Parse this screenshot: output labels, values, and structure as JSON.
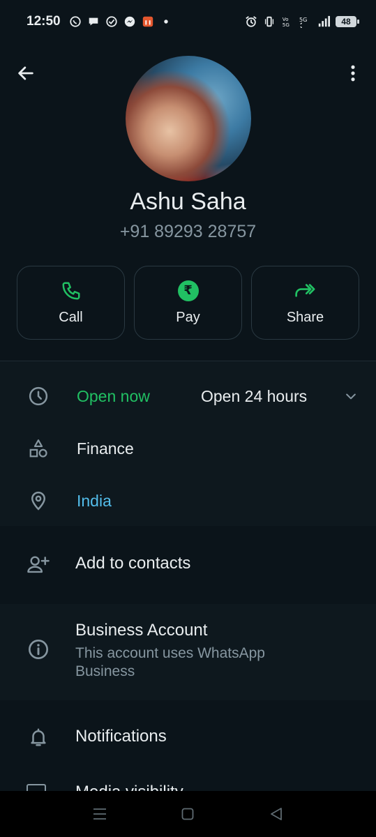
{
  "status_bar": {
    "time": "12:50",
    "left_icons": [
      "whatsapp-icon",
      "chat-bubble-icon",
      "check-circle-icon",
      "messenger-icon",
      "app-icon",
      "dot-icon"
    ],
    "right_icons": [
      "alarm-icon",
      "vibrate-icon",
      "volte-icon",
      "wifi-5g-icon",
      "signal-icon"
    ],
    "battery": "48"
  },
  "contact": {
    "name": "Ashu Saha",
    "phone": "+91 89293 28757"
  },
  "actions": [
    {
      "label": "Call",
      "icon": "phone-icon"
    },
    {
      "label": "Pay",
      "icon": "rupee-icon"
    },
    {
      "label": "Share",
      "icon": "share-icon"
    }
  ],
  "business_info": {
    "status": "Open now",
    "hours": "Open 24 hours",
    "category": "Finance",
    "location": "India"
  },
  "add_contact": "Add to contacts",
  "business_account": {
    "title": "Business Account",
    "subtitle": "This account uses WhatsApp Business"
  },
  "notifications": "Notifications",
  "media_visibility": "Media visibility",
  "colors": {
    "background": "#0b141a",
    "accent_green": "#21c063",
    "link_blue": "#53bdeb",
    "muted": "#8696a0"
  }
}
